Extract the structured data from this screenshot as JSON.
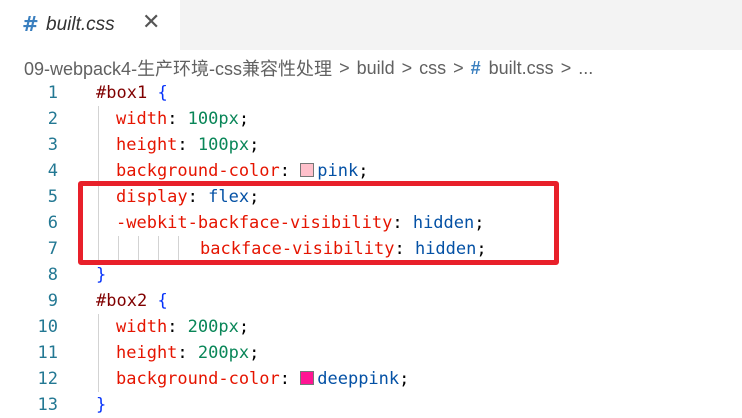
{
  "tab": {
    "icon": "#",
    "label": "built.css",
    "close": "✕"
  },
  "breadcrumb": {
    "items": [
      "09-webpack4-生产环境-css兼容性处理",
      "build",
      "css"
    ],
    "file_icon": "#",
    "file": "built.css",
    "more": "...",
    "separator": ">"
  },
  "code": {
    "lines": [
      {
        "n": "1",
        "selector": "#box1",
        "open": "{"
      },
      {
        "n": "2",
        "prop": "width",
        "value": "100px",
        "vtype": "num"
      },
      {
        "n": "3",
        "prop": "height",
        "value": "100px",
        "vtype": "num"
      },
      {
        "n": "4",
        "prop": "background-color",
        "value": "pink",
        "vtype": "val",
        "swatch": "#ffc0cb"
      },
      {
        "n": "5",
        "prop": "display",
        "value": "flex",
        "vtype": "val"
      },
      {
        "n": "6",
        "prop": "-webkit-backface-visibility",
        "value": "hidden",
        "vtype": "val"
      },
      {
        "n": "7",
        "prop": "backface-visibility",
        "value": "hidden",
        "vtype": "val"
      },
      {
        "n": "8",
        "close": "}"
      },
      {
        "n": "9",
        "selector": "#box2",
        "open": "{"
      },
      {
        "n": "10",
        "prop": "width",
        "value": "200px",
        "vtype": "num"
      },
      {
        "n": "11",
        "prop": "height",
        "value": "200px",
        "vtype": "num"
      },
      {
        "n": "12",
        "prop": "background-color",
        "value": "deeppink",
        "vtype": "val",
        "swatch": "#ff1493"
      },
      {
        "n": "13",
        "close": "}"
      }
    ]
  },
  "colors": {
    "highlight_border": "#e8202a",
    "selector": "#800000",
    "property": "#e51400",
    "number": "#098658",
    "keyword": "#0451a5",
    "line_number": "#237893"
  }
}
